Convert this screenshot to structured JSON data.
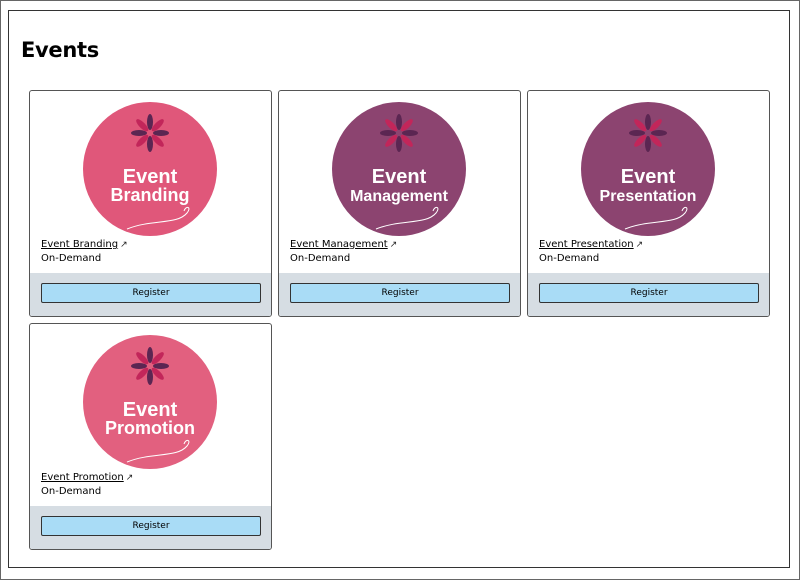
{
  "page": {
    "title": "Events"
  },
  "events": [
    {
      "name": "Event Branding",
      "logo_line1": "Event",
      "logo_line2": "Branding",
      "status": "On-Demand",
      "button": "Register",
      "color": "#e0577a"
    },
    {
      "name": "Event Management",
      "logo_line1": "Event",
      "logo_line2": "Management",
      "status": "On-Demand",
      "button": "Register",
      "color": "#8c4470"
    },
    {
      "name": "Event Presentation",
      "logo_line1": "Event",
      "logo_line2": "Presentation",
      "status": "On-Demand",
      "button": "Register",
      "color": "#8c4470"
    },
    {
      "name": "Event Promotion",
      "logo_line1": "Event",
      "logo_line2": "Promotion",
      "status": "On-Demand",
      "button": "Register",
      "color": "#e2607f"
    }
  ],
  "icons": {
    "external_link": "external-link-icon",
    "logo_flower": "flower-icon"
  },
  "colors": {
    "button_bg": "#a9dcf6",
    "footer_bg": "#d6dde3",
    "flower_dark": "#5b2652",
    "flower_accent": "#c2265a"
  }
}
